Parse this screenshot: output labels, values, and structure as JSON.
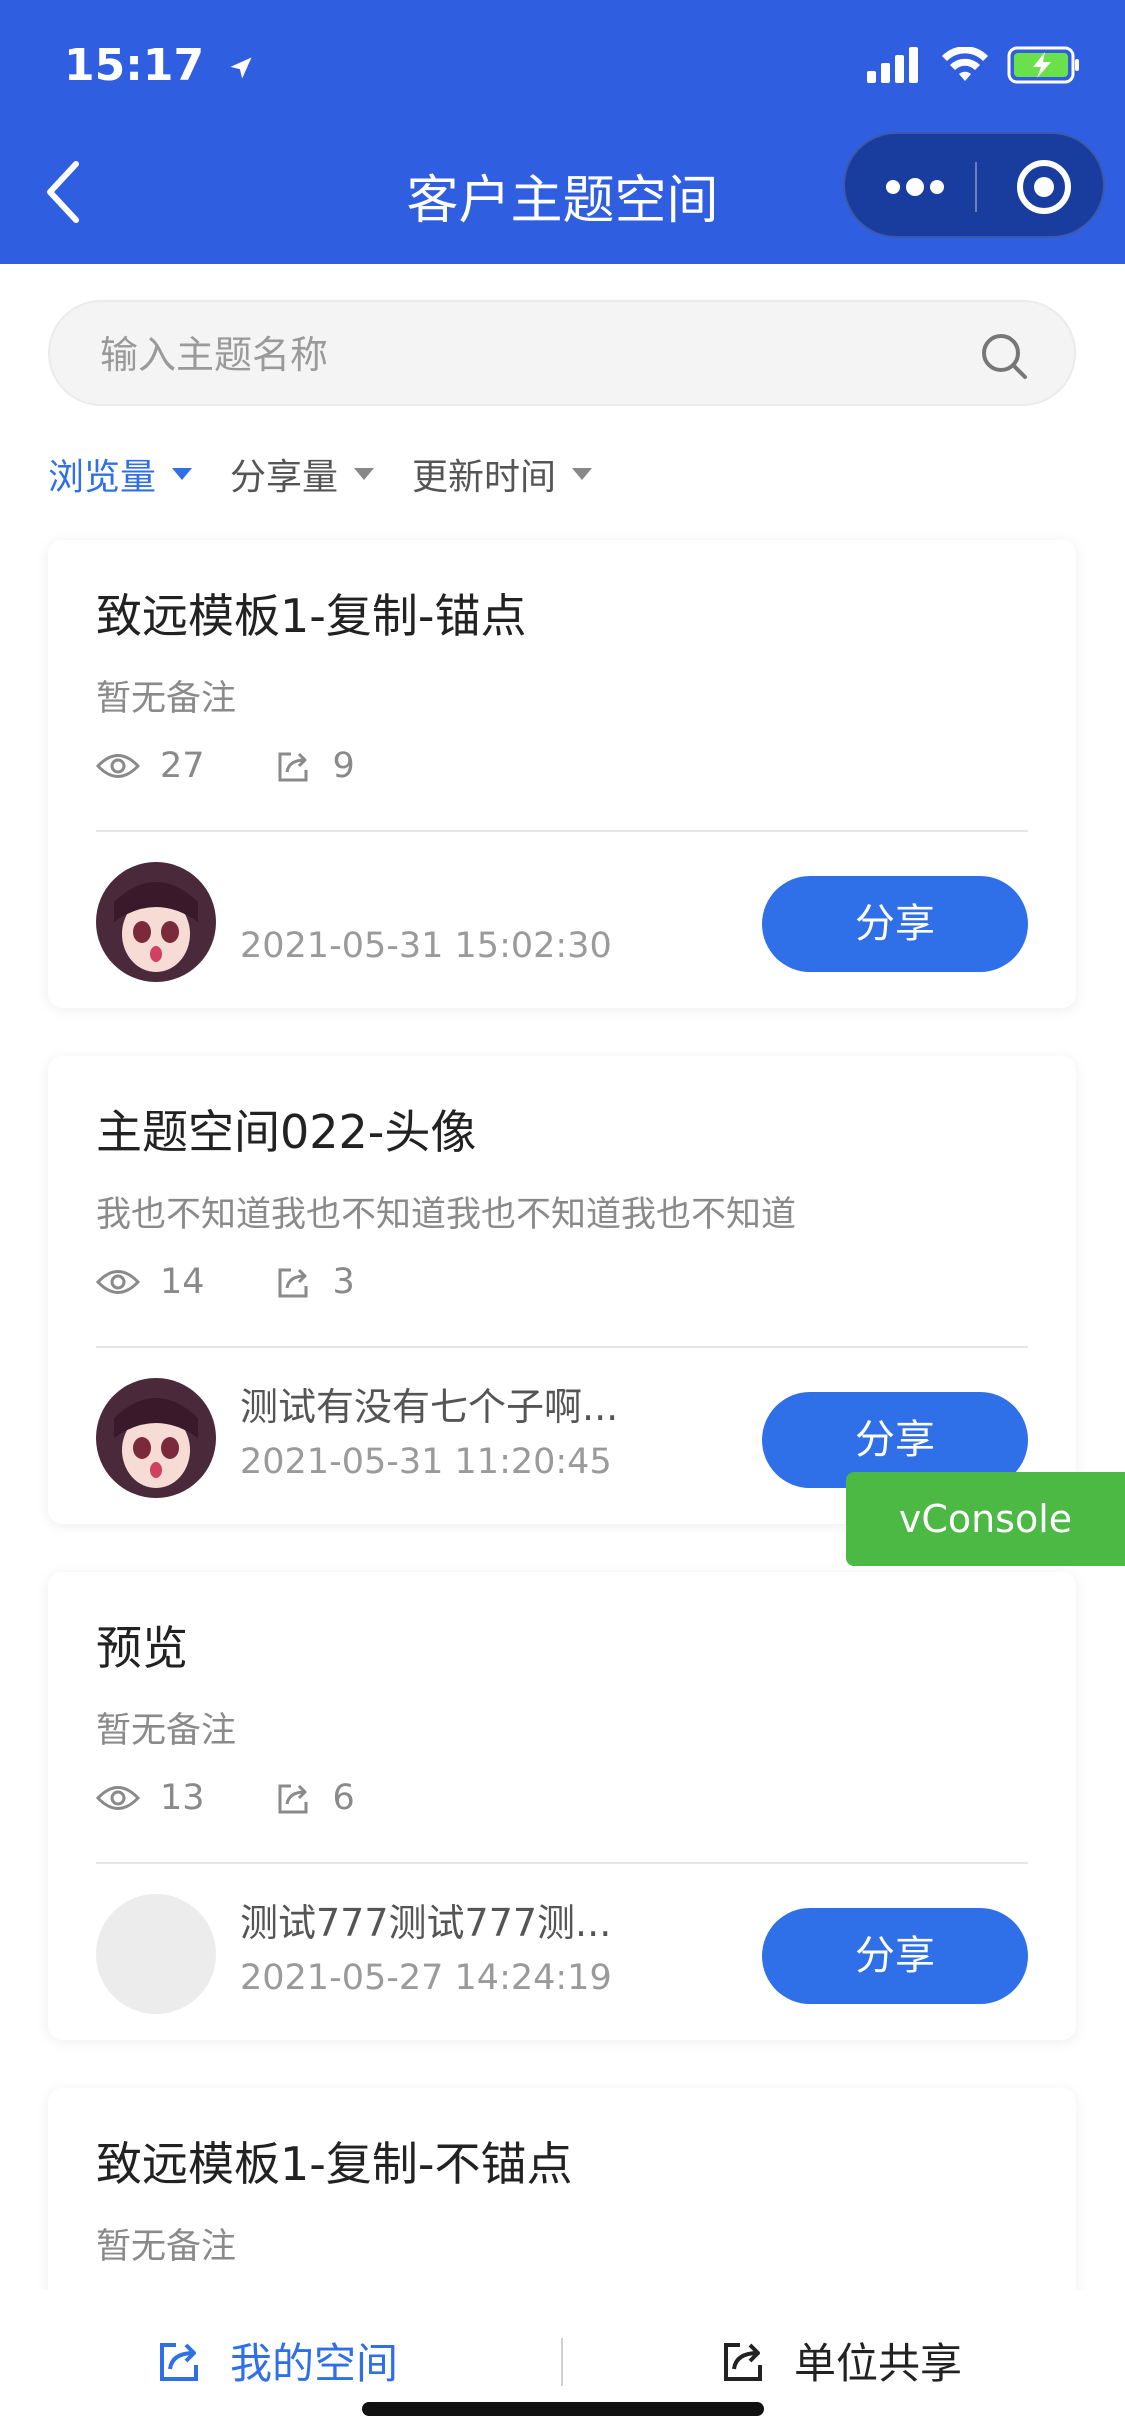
{
  "status_bar": {
    "time": "15:17"
  },
  "nav": {
    "title": "客户主题空间"
  },
  "search": {
    "placeholder": "输入主题名称"
  },
  "sort": [
    {
      "label": "浏览量",
      "active": true
    },
    {
      "label": "分享量",
      "active": false
    },
    {
      "label": "更新时间",
      "active": false
    }
  ],
  "cards": [
    {
      "title": "致远模板1-复制-锚点",
      "note": "暂无备注",
      "views": "27",
      "shares": "9",
      "owner": "",
      "date": "2021-05-31 15:02:30",
      "button": "分享"
    },
    {
      "title": "主题空间022-头像",
      "note": "我也不知道我也不知道我也不知道我也不知道",
      "views": "14",
      "shares": "3",
      "owner": "测试有没有七个子啊...",
      "date": "2021-05-31 11:20:45",
      "button": "分享"
    },
    {
      "title": "预览",
      "note": "暂无备注",
      "views": "13",
      "shares": "6",
      "owner": "测试777测试777测...",
      "date": "2021-05-27 14:24:19",
      "button": "分享"
    },
    {
      "title": "致远模板1-复制-不锚点",
      "note": "暂无备注"
    }
  ],
  "vconsole": {
    "label": "vConsole"
  },
  "bottom_tabs": [
    {
      "label": "我的空间",
      "icon": "share-out-icon",
      "active": true
    },
    {
      "label": "单位共享",
      "icon": "share-out-icon",
      "active": false
    }
  ],
  "colors": {
    "primary": "#2f5fe0",
    "button": "#2f6fe8",
    "vconsole": "#4cb944"
  }
}
